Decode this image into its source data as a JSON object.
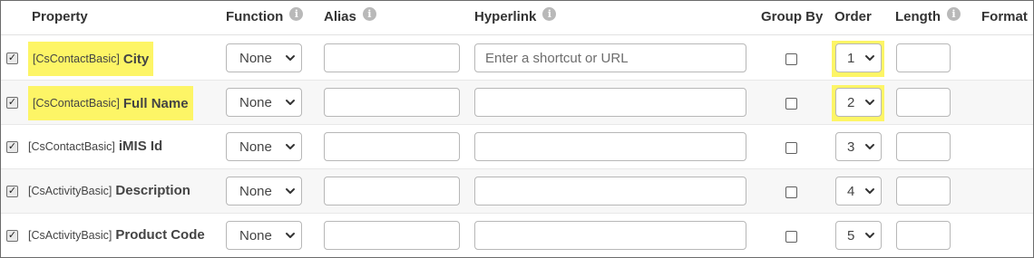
{
  "headers": {
    "property": "Property",
    "function": "Function",
    "alias": "Alias",
    "hyperlink": "Hyperlink",
    "group_by": "Group By",
    "order": "Order",
    "length": "Length",
    "format": "Format"
  },
  "info_icon_glyph": "i",
  "checkmark_glyph": "✓",
  "highlight_color": "#fdf566",
  "rows": [
    {
      "object": "[CsContactBasic]",
      "name": "City",
      "function": "None",
      "alias": "",
      "hyperlink_placeholder": "Enter a shortcut or URL",
      "order": "1",
      "length": "",
      "selected": true,
      "group_by": false,
      "highlighted": true
    },
    {
      "object": "[CsContactBasic]",
      "name": "Full Name",
      "function": "None",
      "alias": "",
      "hyperlink_placeholder": "",
      "order": "2",
      "length": "",
      "selected": true,
      "group_by": false,
      "highlighted": true
    },
    {
      "object": "[CsContactBasic]",
      "name": "iMIS Id",
      "function": "None",
      "alias": "",
      "hyperlink_placeholder": "",
      "order": "3",
      "length": "",
      "selected": true,
      "group_by": false,
      "highlighted": false
    },
    {
      "object": "[CsActivityBasic]",
      "name": "Description",
      "function": "None",
      "alias": "",
      "hyperlink_placeholder": "",
      "order": "4",
      "length": "",
      "selected": true,
      "group_by": false,
      "highlighted": false
    },
    {
      "object": "[CsActivityBasic]",
      "name": "Product Code",
      "function": "None",
      "alias": "",
      "hyperlink_placeholder": "",
      "order": "5",
      "length": "",
      "selected": true,
      "group_by": false,
      "highlighted": false
    }
  ]
}
